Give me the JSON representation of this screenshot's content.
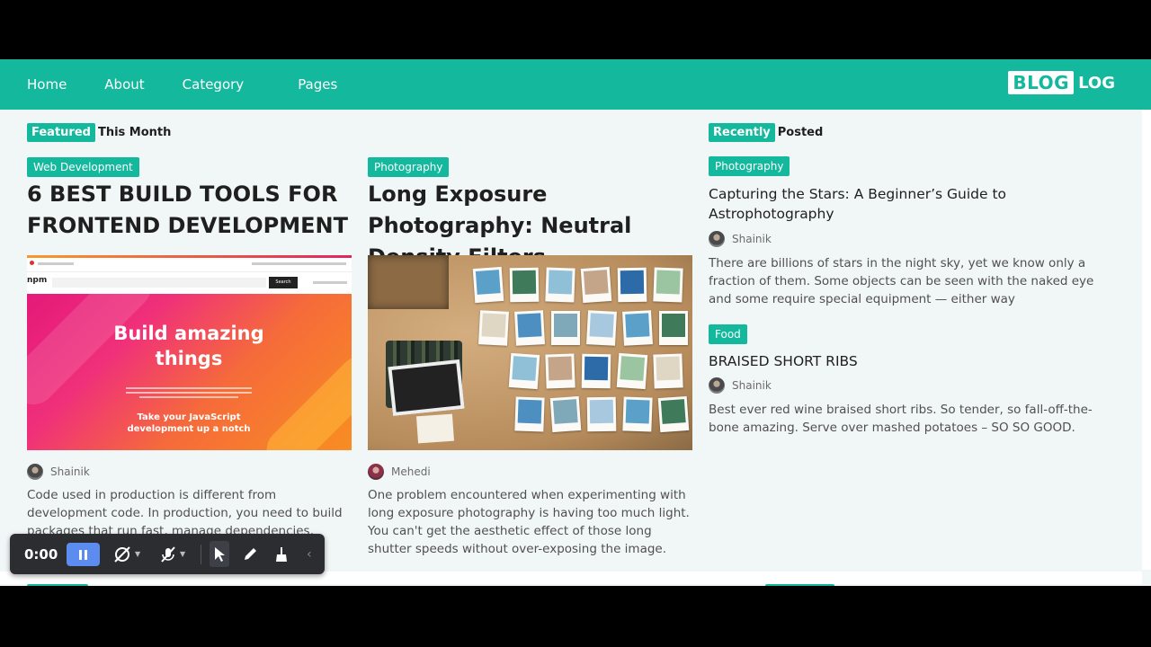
{
  "nav": {
    "items": [
      "Home",
      "About",
      "Category",
      "Pages"
    ]
  },
  "logo": {
    "box": "BLOG",
    "rest": "LOG"
  },
  "featured": {
    "highlight": "Featured",
    "rest": "This Month"
  },
  "recent": {
    "highlight": "Recently",
    "rest": "Posted"
  },
  "featured_posts": [
    {
      "tag": "Web Development",
      "title": "6 BEST BUILD TOOLS FOR FRONTEND DEVELOPMENT",
      "author": "Shainik",
      "excerpt": "Code used in production is different from development code. In production, you need to build packages that run fast, manage dependencies,",
      "image": {
        "headline": "Build amazing things",
        "sub": "Take your JavaScript development up a notch",
        "brand": "npm",
        "search_btn": "Search"
      }
    },
    {
      "tag": "Photography",
      "title": "Long Exposure Photography: Neutral Density Filters",
      "author": "Mehedi",
      "excerpt": "One problem encountered when experimenting with long exposure photography is having too much light. You can't get the aesthetic effect of those long shutter speeds without over-exposing the image."
    }
  ],
  "recent_posts": [
    {
      "tag": "Photography",
      "title": "Capturing the Stars: A Beginner’s Guide to Astrophotography",
      "author": "Shainik",
      "excerpt": "There are billions of stars in the night sky, yet we know only a fraction of them. Some objects can be seen with the naked eye and some require special equipment — either way"
    },
    {
      "tag": "Food",
      "title": "BRAISED SHORT RIBS",
      "author": "Shainik",
      "excerpt": "Best ever red wine braised short ribs. So tender, so fall-off-the-bone amazing. Serve over mashed potatoes – SO SO GOOD."
    }
  ],
  "recorder": {
    "time": "0:00"
  },
  "colors": {
    "accent": "#13b89d",
    "recorder_bg": "#2b2d31",
    "pause_btn": "#5c8cf0"
  }
}
